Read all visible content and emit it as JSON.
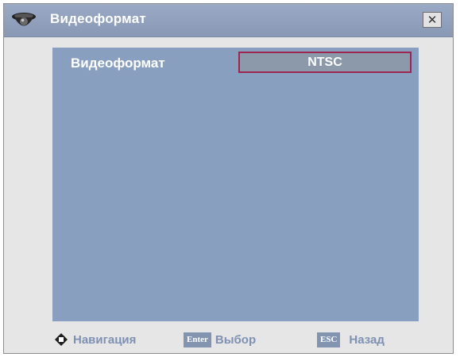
{
  "window": {
    "title": "Видеоформат",
    "close_label": "✕",
    "icon": "camera-icon"
  },
  "setting": {
    "label": "Видеоформат",
    "value": "NTSC"
  },
  "footer": {
    "navigation": {
      "icon": "navigation-arrows-icon",
      "label": "Навигация"
    },
    "select": {
      "key": "Enter",
      "label": "Выбор"
    },
    "back": {
      "key": "ESC",
      "label": "Назад"
    }
  },
  "colors": {
    "titlebar": "#8999b5",
    "panel": "#899fbf",
    "selection_border": "#9b2651",
    "footer_text": "#7e91b2"
  }
}
